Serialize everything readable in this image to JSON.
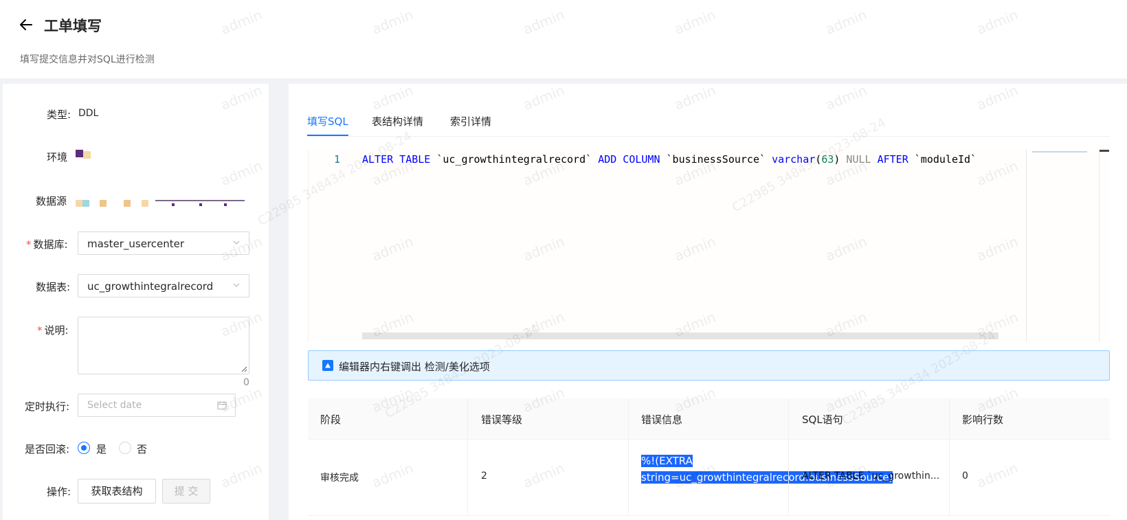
{
  "header": {
    "title": "工单填写",
    "subtitle": "填写提交信息并对SQL进行检测"
  },
  "form": {
    "type_label": "类型:",
    "type_value": "DDL",
    "env_label": "环境",
    "datasource_label": "数据源",
    "database_label": "数据库:",
    "database_value": "master_usercenter",
    "table_label": "数据表:",
    "table_value": "uc_growthintegralrecord",
    "desc_label": "说明:",
    "desc_count": "0",
    "schedule_label": "定时执行:",
    "schedule_placeholder": "Select date",
    "rollback_label": "是否回滚:",
    "rollback_yes": "是",
    "rollback_no": "否",
    "actions_label": "操作:",
    "fetch_button": "获取表结构",
    "submit_button": "提 交"
  },
  "tabs": {
    "items": [
      "填写SQL",
      "表结构详情",
      "索引详情"
    ],
    "active": 0
  },
  "editor": {
    "line_number": "1",
    "code": {
      "p1": "ALTER TABLE",
      "p2": " `uc_growthintegralrecord` ",
      "p3": "ADD COLUMN",
      "p4": " `businessSource` ",
      "p5": "varchar",
      "p6": "(",
      "p7": "63",
      "p8": ")",
      "p9": " NULL ",
      "p10": "AFTER",
      "p11": " `moduleId`"
    }
  },
  "alert": {
    "text": "编辑器内右键调出 检测/美化选项"
  },
  "table": {
    "columns": [
      "阶段",
      "错误等级",
      "错误信息",
      "SQL语句",
      "影响行数"
    ],
    "rows": [
      {
        "stage": "审核完成",
        "level": "2",
        "message": "%!(EXTRA string=uc_growthintegralrecord.businessSource)",
        "sql": "ALTER TABLE `uc_growthin...",
        "affected": "0"
      }
    ]
  },
  "watermark": {
    "user": "admin",
    "stamp": "C22985 348434 2023-08-24"
  },
  "colors": {
    "primary": "#1677ff",
    "required": "#ff4d4f",
    "alert_bg": "#e6f4ff",
    "alert_border": "#91caff",
    "highlight": "#1a66ff"
  }
}
